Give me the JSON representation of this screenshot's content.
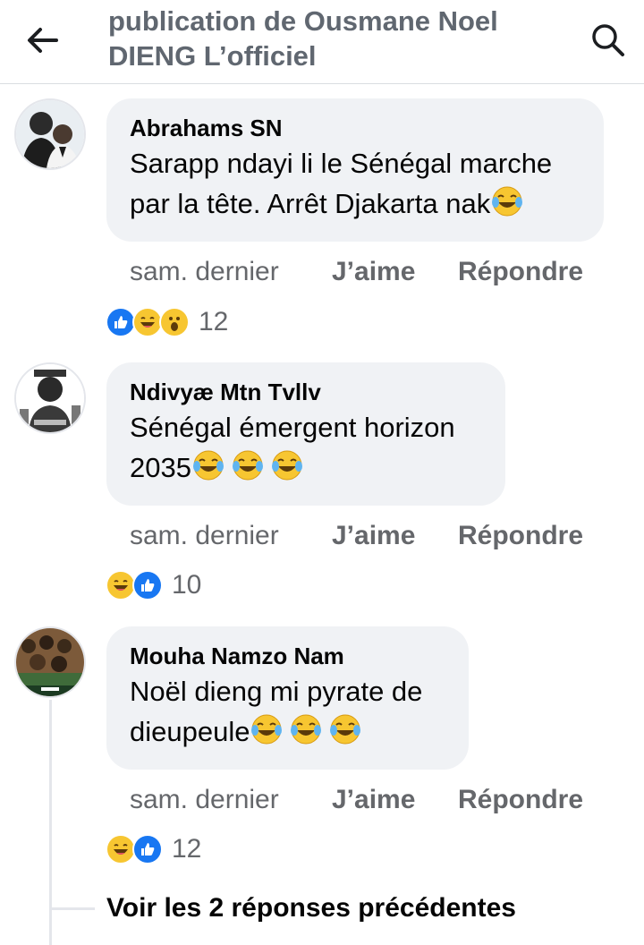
{
  "header": {
    "title_line1": "publication de Ousmane Noel",
    "title_line2": "DIENG L’officiel",
    "back_icon": "arrow-left-icon",
    "search_icon": "search-icon"
  },
  "comments": [
    {
      "author": "Abrahams SN",
      "line1": "Sarapp ndayi li le Sénégal marche",
      "line2": "par la tête. Arrêt Djakarta nak",
      "time": "sam. dernier",
      "like": "J’aime",
      "reply": "Répondre",
      "reaction_count": "12",
      "reactions": [
        "like-icon",
        "haha-icon",
        "wow-icon"
      ]
    },
    {
      "author": "Ndivyæ Mtn Tvllv",
      "line1": "Sénégal émergent horizon",
      "line2": "2035",
      "time": "sam. dernier",
      "like": "J’aime",
      "reply": "Répondre",
      "reaction_count": "10",
      "reactions": [
        "haha-icon",
        "like-icon"
      ]
    },
    {
      "author": "Mouha Namzo Nam",
      "line1": "Noël dieng mi pyrate de",
      "line2": "dieupeule",
      "time": "sam. dernier",
      "like": "J’aime",
      "reply": "Répondre",
      "reaction_count": "12",
      "reactions": [
        "haha-icon",
        "like-icon"
      ]
    }
  ],
  "see_replies": "Voir les 2 réponses précédentes",
  "colors": {
    "bubble": "#f0f2f5",
    "muted": "#65676b",
    "like_blue": "#1877f2",
    "emoji_yellow": "#f7c631"
  }
}
